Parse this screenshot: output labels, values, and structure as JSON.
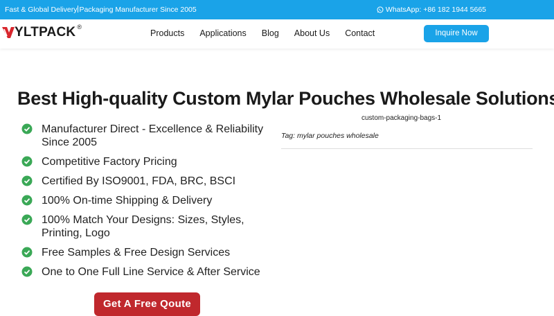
{
  "topbar": {
    "left_part1": "Fast & Global Delivery",
    "left_part2": "Packaging Manufacturer Since 2005",
    "whatsapp": "WhatsApp: +86 182 1944 5665"
  },
  "header": {
    "logo_text": "YLTPACK",
    "logo_reg": "®",
    "nav": [
      "Products",
      "Applications",
      "Blog",
      "About Us",
      "Contact"
    ],
    "inquire_label": "Inquire Now"
  },
  "main": {
    "title": "Best High-quality Custom Mylar Pouches Wholesale Solutions",
    "features": [
      "Manufacturer Direct - Excellence & Reliability Since 2005",
      "Competitive Factory Pricing",
      "Certified By ISO9001, FDA, BRC, BSCI",
      "100% On-time Shipping & Delivery",
      "100% Match Your Designs: Sizes, Styles, Printing, Logo",
      "Free Samples & Free Design Services",
      "One to One Full Line Service & After Service"
    ],
    "image_caption": "custom-packaging-bags-1",
    "tag_line": "Tag: mylar pouches wholesale",
    "cta_label": "Get A Free Qoute"
  },
  "colors": {
    "accent": "#1aa3e8",
    "check_green": "#3aa856",
    "cta_red": "#c0282d",
    "logo_red": "#d8262d"
  }
}
